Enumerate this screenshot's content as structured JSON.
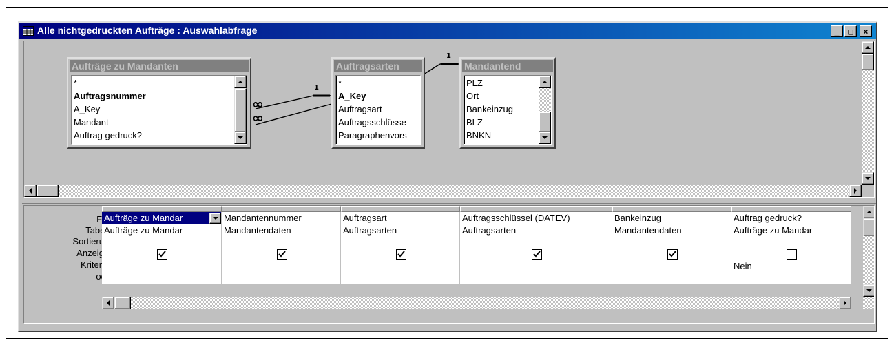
{
  "window": {
    "title": "Alle nichtgedruckten Aufträge : Auswahlabfrage",
    "title_gradient_start": "#000080",
    "title_gradient_end": "#1084d0",
    "buttons": {
      "minimize": "_",
      "maximize": "□",
      "close": "×"
    }
  },
  "tables": [
    {
      "title": "Aufträge zu Mandanten",
      "fields": [
        {
          "label": "*",
          "bold": false
        },
        {
          "label": "Auftragsnummer",
          "bold": true
        },
        {
          "label": "A_Key",
          "bold": false
        },
        {
          "label": "Mandant",
          "bold": false
        },
        {
          "label": "Auftrag gedruck?",
          "bold": false
        }
      ]
    },
    {
      "title": "Auftragsarten",
      "fields": [
        {
          "label": "*",
          "bold": false
        },
        {
          "label": "A_Key",
          "bold": true
        },
        {
          "label": "Auftragsart",
          "bold": false
        },
        {
          "label": "Auftragsschlüsse",
          "bold": false
        },
        {
          "label": "Paragraphenvors",
          "bold": false
        }
      ]
    },
    {
      "title": "Mandantend",
      "fields": [
        {
          "label": "PLZ",
          "bold": false
        },
        {
          "label": "Ort",
          "bold": false
        },
        {
          "label": "Bankeinzug",
          "bold": false
        },
        {
          "label": "BLZ",
          "bold": false
        },
        {
          "label": "BNKN",
          "bold": false
        }
      ]
    }
  ],
  "joins": {
    "one_label": "1",
    "many_label": "∞"
  },
  "grid": {
    "row_labels": [
      "Feld:",
      "Tabelle:",
      "Sortierung:",
      "Anzeigen:",
      "Kriterien:",
      "oder:"
    ],
    "columns": [
      {
        "field": "Aufträge zu Mandar",
        "table": "Aufträge zu Mandar",
        "sort": "",
        "show": true,
        "criteria": "",
        "or": ""
      },
      {
        "field": "Mandantennummer",
        "table": "Mandantendaten",
        "sort": "",
        "show": true,
        "criteria": "",
        "or": ""
      },
      {
        "field": "Auftragsart",
        "table": "Auftragsarten",
        "sort": "",
        "show": true,
        "criteria": "",
        "or": ""
      },
      {
        "field": "Auftragsschlüssel (DATEV)",
        "table": "Auftragsarten",
        "sort": "",
        "show": true,
        "criteria": "",
        "or": ""
      },
      {
        "field": "Bankeinzug",
        "table": "Mandantendaten",
        "sort": "",
        "show": true,
        "criteria": "",
        "or": ""
      },
      {
        "field": "Auftrag gedruck?",
        "table": "Aufträge zu Mandar",
        "sort": "",
        "show": false,
        "criteria": "Nein",
        "or": ""
      }
    ]
  }
}
